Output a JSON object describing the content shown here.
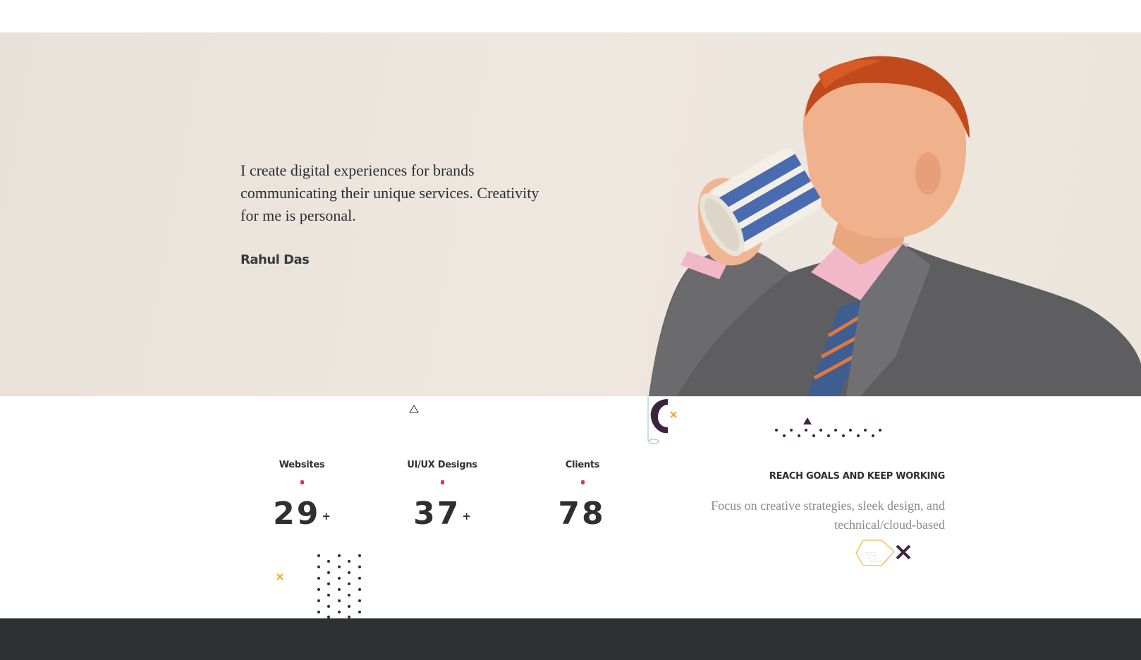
{
  "hero": {
    "quote": "I create digital experiences for brands communicating their unique services. Creativity for me is personal.",
    "author": "Rahul Das"
  },
  "stats": [
    {
      "label": "Websites",
      "value": "29",
      "suffix": "+"
    },
    {
      "label": "UI/UX Designs",
      "value": "37",
      "suffix": "+"
    },
    {
      "label": "Clients",
      "value": "78",
      "suffix": ""
    }
  ],
  "goals": {
    "title": "REACH GOALS AND KEEP WORKING",
    "text": "Focus on creative strategies, sleek design, and technical/cloud-based"
  },
  "colors": {
    "accent_red": "#d93a4a",
    "accent_orange": "#f5a623",
    "deco_purple": "#3c2440",
    "footer": "#2d3031"
  }
}
